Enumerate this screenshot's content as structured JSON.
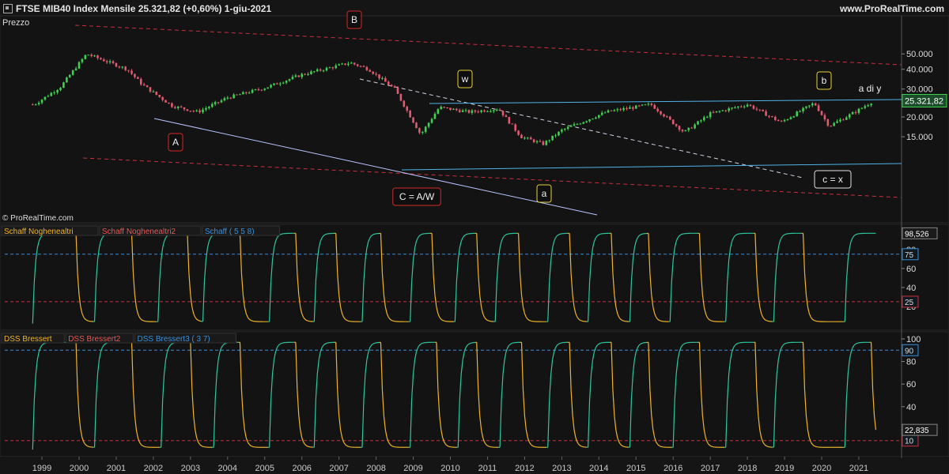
{
  "header": {
    "title": "FTSE MIB40 Index   Mensile    25.321,82 (+0,60%)    1-giu-2021",
    "site": "www.ProRealTime.com"
  },
  "panels": {
    "price_label": "Prezzo",
    "copyright": "© ProRealTime.com",
    "schaff_legend": [
      "Schaff Noghenealtri",
      "Schaff Noghenealtri2",
      "Schaff ( 5 5 8)"
    ],
    "dss_legend": [
      "DSS Bressert",
      "DSS Bressert2",
      "DSS Bressert3 ( 3 7)"
    ]
  },
  "annotations": [
    {
      "text": "A",
      "style": "red"
    },
    {
      "text": "B",
      "style": "red"
    },
    {
      "text": "C = A/W",
      "style": "red"
    },
    {
      "text": "w",
      "style": "yellow"
    },
    {
      "text": "a",
      "style": "yellow"
    },
    {
      "text": "b",
      "style": "yellow"
    },
    {
      "text": "c = x",
      "style": "white"
    },
    {
      "text": "a di y",
      "style": "plain"
    }
  ],
  "colors": {
    "background": "#0f0f0f",
    "up": "#3fcf52",
    "down": "#e05a70",
    "channel": "#4fb3e8",
    "red_dash": "#c8323c",
    "schaff_rise": "#2ec8a0",
    "schaff_fall": "#f0b428",
    "level_blue": "#3a8fd8",
    "level_red": "#c8323c"
  },
  "chart_data": [
    {
      "type": "candlestick",
      "title": "FTSE MIB40 Index",
      "frequency": "Mensile",
      "last_value": "25.321,82",
      "x_ticks": [
        "1999",
        "2000",
        "2001",
        "2002",
        "2003",
        "2004",
        "2005",
        "2006",
        "2007",
        "2008",
        "2009",
        "2010",
        "2011",
        "2012",
        "2013",
        "2014",
        "2015",
        "2016",
        "2017",
        "2018",
        "2019",
        "2020",
        "2021"
      ],
      "y_ticks": [
        "50.000",
        "40.000",
        "30.000",
        "20.000",
        "15.000"
      ],
      "scale": "log",
      "ylim": [
        9000,
        52000
      ],
      "closes": [
        {
          "x": 1998.8,
          "y": 24000
        },
        {
          "x": 1999.5,
          "y": 31000
        },
        {
          "x": 2000.2,
          "y": 50000
        },
        {
          "x": 2001.3,
          "y": 40000
        },
        {
          "x": 2001.7,
          "y": 32000
        },
        {
          "x": 2002.5,
          "y": 23500
        },
        {
          "x": 2003.2,
          "y": 21500
        },
        {
          "x": 2004.0,
          "y": 26500
        },
        {
          "x": 2005.0,
          "y": 30500
        },
        {
          "x": 2006.0,
          "y": 37000
        },
        {
          "x": 2007.3,
          "y": 44000
        },
        {
          "x": 2007.8,
          "y": 40000
        },
        {
          "x": 2008.5,
          "y": 30000
        },
        {
          "x": 2009.2,
          "y": 15500
        },
        {
          "x": 2009.7,
          "y": 23000
        },
        {
          "x": 2010.5,
          "y": 21500
        },
        {
          "x": 2011.3,
          "y": 22500
        },
        {
          "x": 2011.9,
          "y": 15000
        },
        {
          "x": 2012.5,
          "y": 13500
        },
        {
          "x": 2013.0,
          "y": 16500
        },
        {
          "x": 2014.2,
          "y": 21500
        },
        {
          "x": 2015.4,
          "y": 24000
        },
        {
          "x": 2016.3,
          "y": 16000
        },
        {
          "x": 2017.0,
          "y": 21000
        },
        {
          "x": 2018.0,
          "y": 24000
        },
        {
          "x": 2018.9,
          "y": 18500
        },
        {
          "x": 2019.8,
          "y": 24500
        },
        {
          "x": 2020.2,
          "y": 17500
        },
        {
          "x": 2020.9,
          "y": 21500
        },
        {
          "x": 2021.4,
          "y": 25321.82
        }
      ]
    },
    {
      "type": "line",
      "title": "Schaff ( 5 5 8)",
      "ylim": [
        0,
        100
      ],
      "y_ticks": [
        "80",
        "60",
        "40",
        "20"
      ],
      "levels": [
        {
          "value": 75,
          "label": "75"
        },
        {
          "value": 25,
          "label": "25"
        }
      ],
      "last_label": "98,526",
      "cycles": [
        1999.9,
        2000.4,
        2001.4,
        2002.1,
        2002.9,
        2003.3,
        2004.3,
        2005.1,
        2005.8,
        2006.3,
        2006.9,
        2007.6,
        2008.1,
        2008.9,
        2009.5,
        2010.1,
        2010.7,
        2011.2,
        2011.8,
        2012.6,
        2013.2,
        2013.7,
        2014.3,
        2014.8,
        2015.3,
        2015.9,
        2016.7,
        2017.4,
        2018.2,
        2018.7,
        2019.5,
        2020.6,
        2021.5
      ]
    },
    {
      "type": "line",
      "title": "DSS Bressert3 ( 3 7)",
      "ylim": [
        0,
        100
      ],
      "y_ticks": [
        "100",
        "80",
        "60",
        "40",
        "20"
      ],
      "levels": [
        {
          "value": 90,
          "label": "90"
        },
        {
          "value": 10,
          "label": "10"
        }
      ],
      "last_label": "22,835",
      "cycles": [
        1999.9,
        2000.4,
        2001.4,
        2002.2,
        2003.0,
        2003.6,
        2004.3,
        2005.1,
        2005.8,
        2006.3,
        2006.9,
        2007.6,
        2008.1,
        2008.9,
        2009.6,
        2010.2,
        2010.7,
        2011.3,
        2011.9,
        2012.6,
        2013.2,
        2013.7,
        2014.3,
        2014.8,
        2015.3,
        2016.0,
        2016.7,
        2017.4,
        2018.2,
        2018.7,
        2019.5,
        2020.6,
        2021.3
      ]
    }
  ]
}
